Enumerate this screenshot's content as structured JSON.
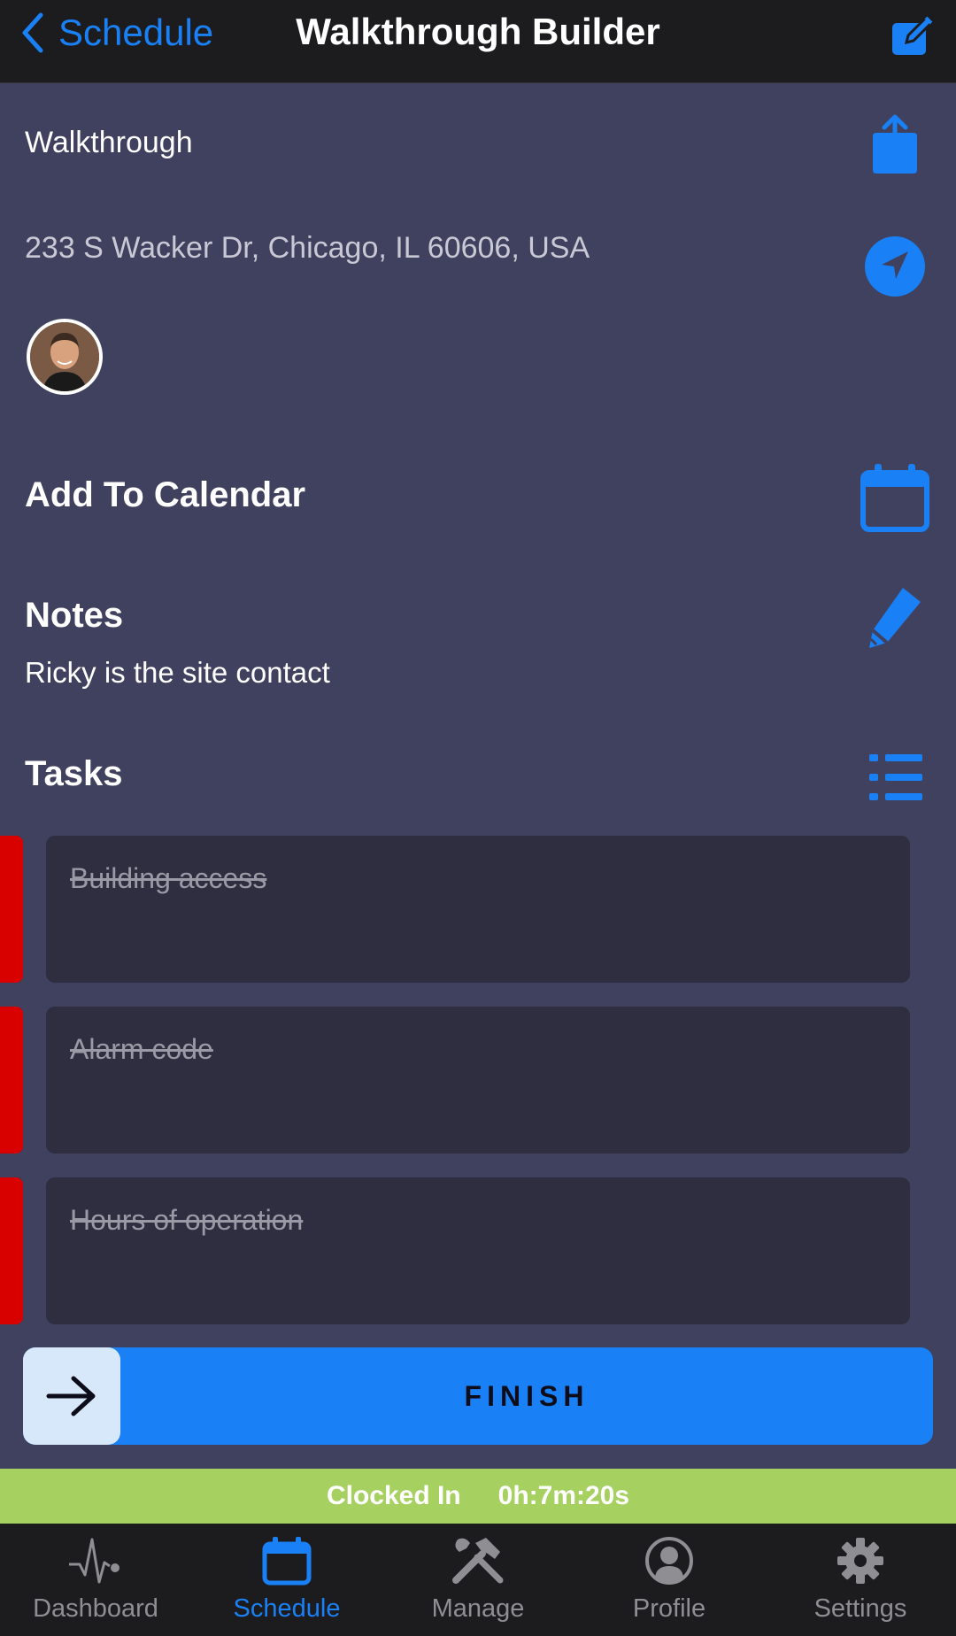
{
  "nav": {
    "back_label": "Schedule",
    "title": "Walkthrough Builder"
  },
  "header": {
    "type_label": "Walkthrough",
    "address": "233 S Wacker Dr, Chicago, IL 60606, USA"
  },
  "calendar": {
    "label": "Add To Calendar"
  },
  "notes": {
    "label": "Notes",
    "text": "Ricky is the site contact"
  },
  "tasks": {
    "label": "Tasks",
    "items": [
      {
        "title": "Building access",
        "completed": true
      },
      {
        "title": "Alarm code",
        "completed": true
      },
      {
        "title": "Hours of operation",
        "completed": true
      }
    ]
  },
  "finish": {
    "label": "FINISH"
  },
  "clock": {
    "status": "Clocked In",
    "elapsed": "0h:7m:20s"
  },
  "tabbar": {
    "items": [
      {
        "label": "Dashboard",
        "icon": "pulse-icon"
      },
      {
        "label": "Schedule",
        "icon": "calendar-icon",
        "active": true
      },
      {
        "label": "Manage",
        "icon": "tools-icon"
      },
      {
        "label": "Profile",
        "icon": "profile-icon"
      },
      {
        "label": "Settings",
        "icon": "gear-icon"
      }
    ]
  },
  "colors": {
    "accent": "#1a80f5",
    "background": "#40405f",
    "task_flag": "#d90000",
    "clock_bar": "#a6d05f"
  }
}
